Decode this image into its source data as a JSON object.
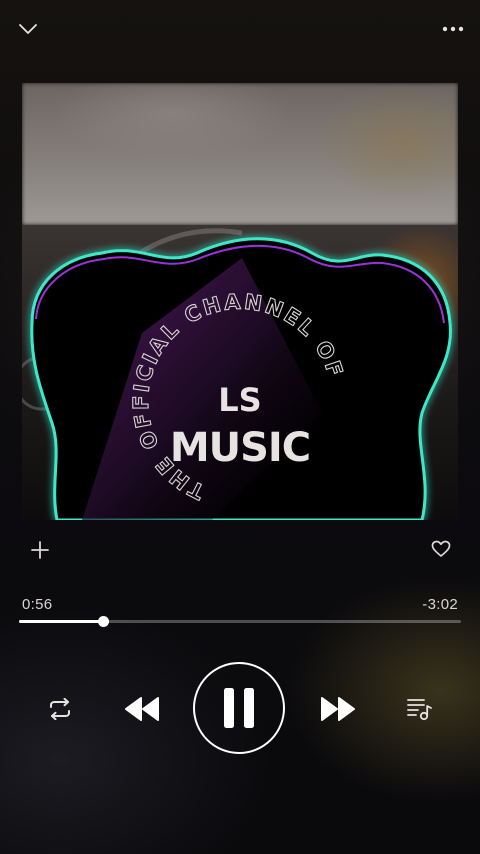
{
  "topbar": {
    "collapse_icon": "chevron-down-icon",
    "more_icon": "more-horizontal-icon"
  },
  "artwork": {
    "logo_line1": "LS",
    "logo_line2": "MUSIC",
    "ring_text": "THE OFFICIAL CHANNEL OF",
    "glow_colors": [
      "#3de8c9",
      "#b23cff"
    ]
  },
  "actions": {
    "add_icon": "plus-icon",
    "like_icon": "heart-outline-icon"
  },
  "playback": {
    "elapsed": "0:56",
    "remaining": "-3:02",
    "progress_fraction": 0.19
  },
  "controls": {
    "repeat_icon": "repeat-icon",
    "previous_icon": "rewind-icon",
    "play_pause_icon": "pause-icon",
    "next_icon": "fast-forward-icon",
    "queue_icon": "queue-icon"
  },
  "colors": {
    "foreground": "#ffffff",
    "track_bg": "rgba(255,255,255,0.28)"
  }
}
